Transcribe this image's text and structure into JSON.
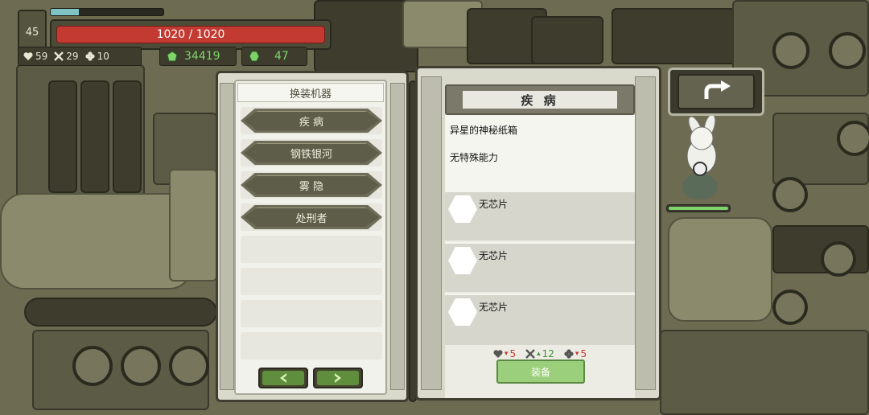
{
  "player": {
    "level": "45",
    "xp_fraction": 0.25,
    "hp_text": "1020 / 1020",
    "stats": {
      "hearts": "59",
      "swords": "29",
      "clovers": "10"
    },
    "gems": "34419",
    "chips": "47"
  },
  "machine_panel": {
    "title": "换装机器",
    "machines": [
      "疾 病",
      "钢铁银河",
      "雾 隐",
      "处刑者"
    ],
    "empty_slots": 4
  },
  "detail_panel": {
    "title": "疾 病",
    "description_1": "异星的神秘纸箱",
    "description_2": "无特殊能力",
    "chip_slots": [
      "无芯片",
      "无芯片",
      "无芯片"
    ],
    "bonus": {
      "hearts": "5",
      "swords": "12",
      "clovers": "5"
    },
    "equip_label": "装备"
  },
  "colors": {
    "hp_red": "#c23a31",
    "currency_green": "#7fd36a",
    "button_green": "#9ccf7c",
    "nav_green": "#5f8f3c"
  },
  "icons": [
    "heart-icon",
    "crossed-swords-icon",
    "clover-icon",
    "gem-icon",
    "chip-icon",
    "back-arrow-icon",
    "chevron-left-icon",
    "chevron-right-icon"
  ]
}
